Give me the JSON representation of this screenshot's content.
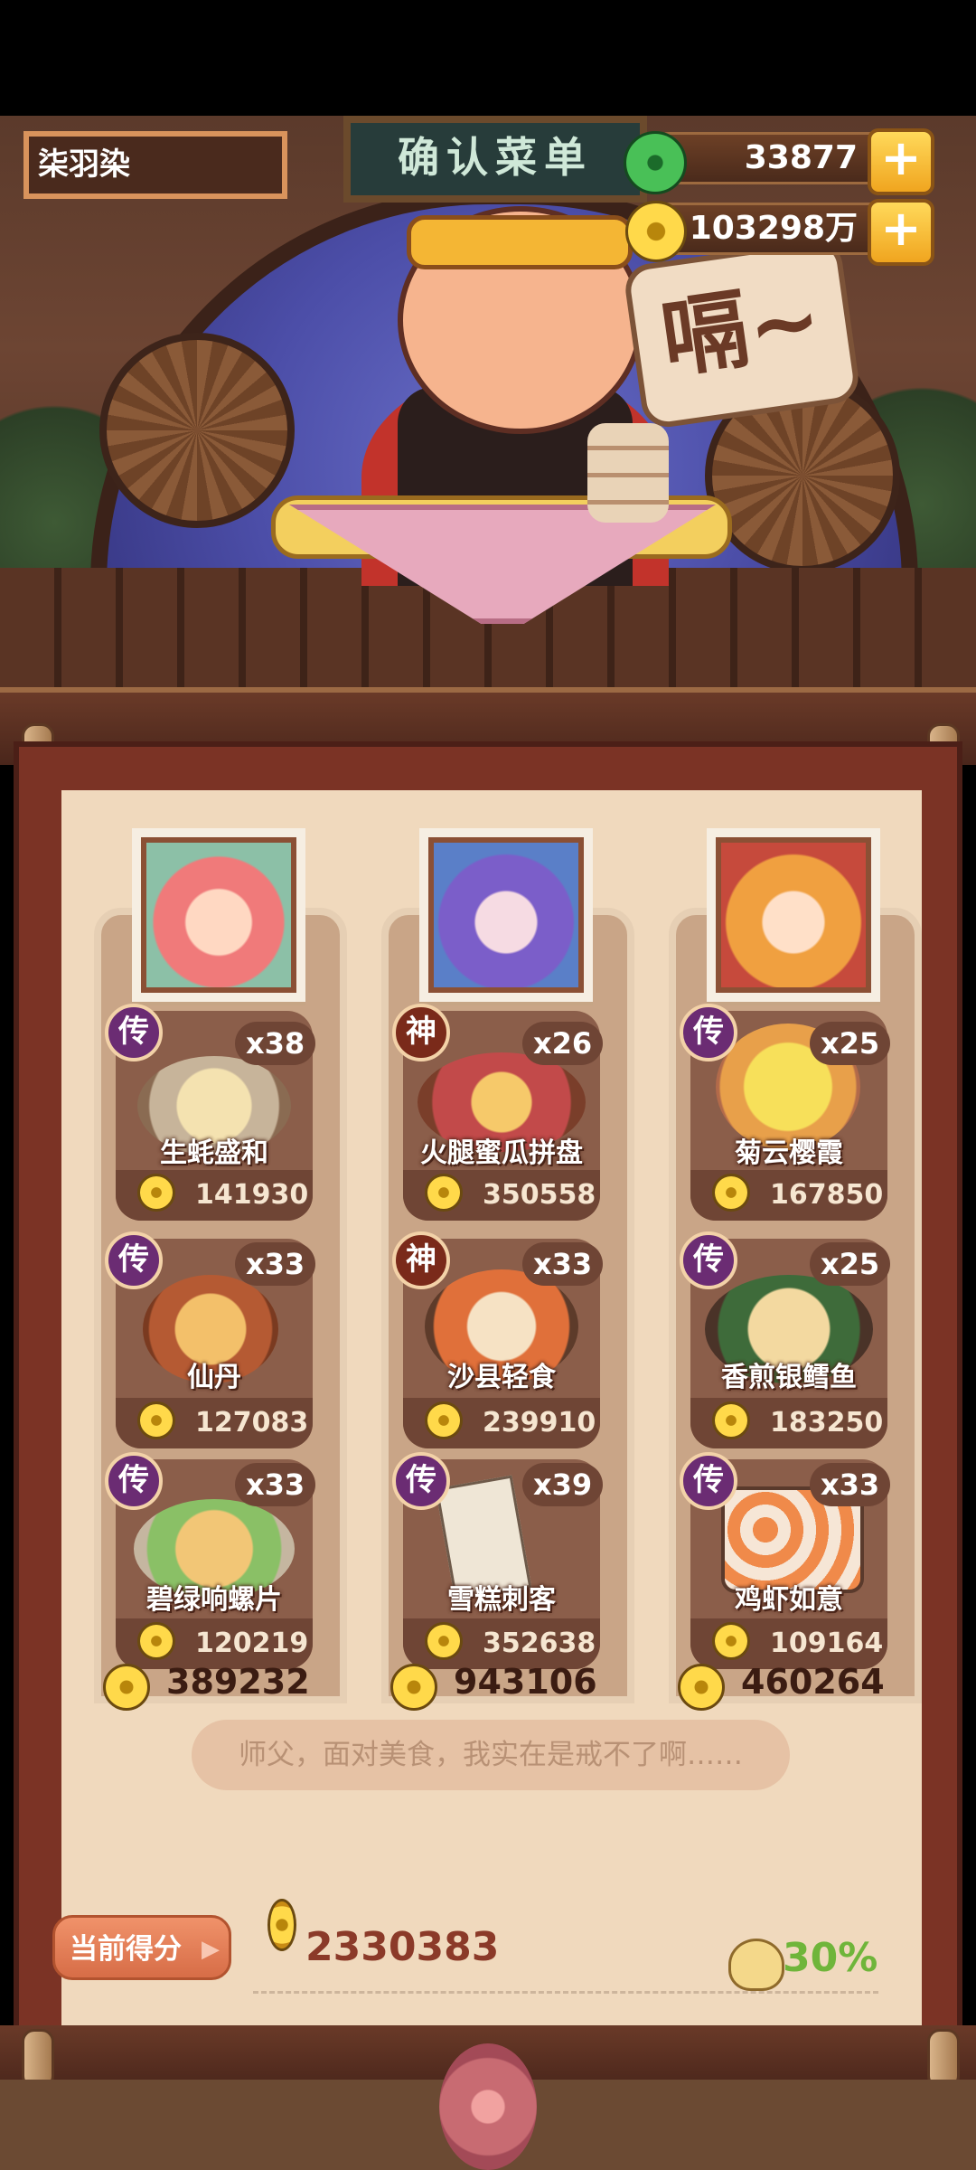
{
  "player": {
    "name": "柒羽染"
  },
  "scene": {
    "sign": "确认菜单",
    "bubble": "嗝~"
  },
  "resources": [
    {
      "icon": "jade-icon",
      "value": "33877"
    },
    {
      "icon": "coin-icon",
      "value": "103298万"
    }
  ],
  "columns": [
    {
      "portrait": "character-1",
      "dishes": [
        {
          "rank": "传",
          "count": "x38",
          "name": "生蚝盛和",
          "price": "141930"
        },
        {
          "rank": "传",
          "count": "x33",
          "name": "仙丹",
          "price": "127083"
        },
        {
          "rank": "传",
          "count": "x33",
          "name": "碧绿响螺片",
          "price": "120219"
        }
      ],
      "total": "389232"
    },
    {
      "portrait": "character-2",
      "dishes": [
        {
          "rank": "神",
          "count": "x26",
          "name": "火腿蜜瓜拼盘",
          "price": "350558"
        },
        {
          "rank": "神",
          "count": "x33",
          "name": "沙县轻食",
          "price": "239910"
        },
        {
          "rank": "传",
          "count": "x39",
          "name": "雪糕刺客",
          "price": "352638"
        }
      ],
      "total": "943106"
    },
    {
      "portrait": "character-3",
      "dishes": [
        {
          "rank": "传",
          "count": "x25",
          "name": "菊云樱霞",
          "price": "167850"
        },
        {
          "rank": "传",
          "count": "x25",
          "name": "香煎银鳕鱼",
          "price": "183250"
        },
        {
          "rank": "传",
          "count": "x33",
          "name": "鸡虾如意",
          "price": "109164"
        }
      ],
      "total": "460264"
    }
  ],
  "quote": "师父，面对美食，我实在是戒不了啊……",
  "score": {
    "label": "当前得分",
    "value": "2330383",
    "percent": "30%"
  },
  "colors": {
    "accent": "#6fb53a",
    "score": "#8b3a29",
    "panel": "#f0d9bd"
  }
}
